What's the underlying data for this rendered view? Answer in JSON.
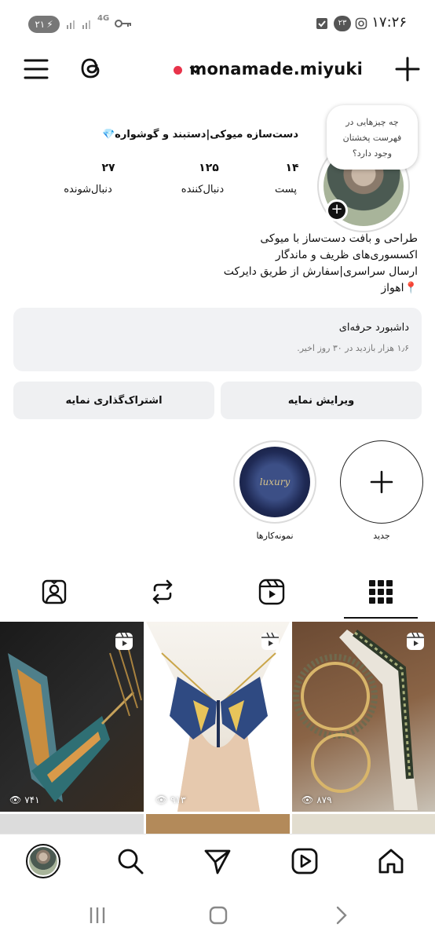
{
  "status_bar": {
    "battery": "۲۱",
    "network": "4G",
    "notification_count": "۲۳",
    "time": "۱۷:۲۶"
  },
  "header": {
    "username": "monamade.miyuki"
  },
  "profile": {
    "note": "چه چیزهایی در فهرست پخشتان وجود دارد؟",
    "display_name": "دست‌سازه میوکی|دستبند و گوشواره💎",
    "stats": [
      {
        "number": "۱۴",
        "label": "پست"
      },
      {
        "number": "۱۲۵",
        "label": "دنبال‌کننده"
      },
      {
        "number": "۲۷",
        "label": "دنبال‌شونده"
      }
    ],
    "bio_lines": [
      "طراحی و بافت دست‌ساز با میوکی",
      "اکسسوری‌های ظریف و ماندگار",
      "ارسال سراسری|سفارش از طریق دایرکت",
      "📍اهواز"
    ]
  },
  "dashboard": {
    "title": "داشبورد حرفه‌ای",
    "subtitle": "۱٫۶ هزار بازدید در ۳۰ روز اخیر."
  },
  "buttons": {
    "edit": "ویرایش نمایه",
    "share": "اشتراک‌گذاری نمایه"
  },
  "highlights": [
    {
      "label": "جدید",
      "icon": "plus-icon"
    },
    {
      "label": "نمونه‌کارها",
      "cover_text": "luxury"
    }
  ],
  "tabs": [
    "grid-icon",
    "reels-icon",
    "reposts-icon",
    "tagged-icon"
  ],
  "posts": [
    {
      "views": "۷۴۱",
      "subject": "bracelet"
    },
    {
      "views": "۹۱۳",
      "subject": "butterfly-necklace"
    },
    {
      "views": "۸۷۹",
      "subject": "earrings"
    }
  ],
  "bottom_nav": [
    "home-icon",
    "reels-icon",
    "send-icon",
    "search-icon",
    "profile-avatar"
  ],
  "colors": {
    "accent_red": "#e8334a",
    "button_bg": "#eff0f2",
    "text": "#111111"
  }
}
